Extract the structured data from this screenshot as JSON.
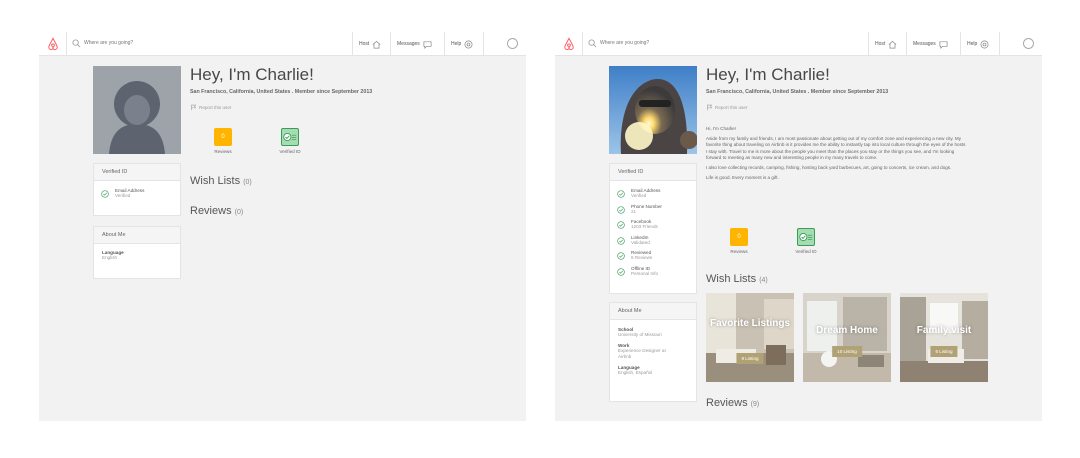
{
  "header": {
    "search_placeholder": "Where are you going?",
    "host_label": "Host",
    "messages_label": "Messages",
    "help_label": "Help"
  },
  "profile": {
    "title": "Hey, I'm Charlie!",
    "location_line": "San Francisco, California, United States . Member since September 2013",
    "report_label": "Report this user",
    "reviews_badge_count": "0",
    "reviews_badge_label": "Reviews",
    "verified_badge_label": "Verified ID",
    "wish_lists_label": "Wish Lists",
    "reviews_label": "Reviews"
  },
  "left": {
    "verified_card_title": "Verified ID",
    "verifications": [
      {
        "name": "Email Address",
        "status": "Verified"
      }
    ],
    "about_title": "About Me",
    "about": [
      {
        "key": "Language",
        "value": "English"
      }
    ],
    "wish_lists_count": "(0)",
    "reviews_count": "(0)"
  },
  "right": {
    "verified_card_title": "Verified ID",
    "verifications": [
      {
        "name": "Email Address",
        "status": "Verified"
      },
      {
        "name": "Phone Number",
        "status": "21"
      },
      {
        "name": "Facebook",
        "status": "1203 Friends"
      },
      {
        "name": "LinkedIn",
        "status": "Validated"
      },
      {
        "name": "Reviewed",
        "status": "6 Reviews"
      },
      {
        "name": "Offline ID",
        "status": "Personal Info"
      }
    ],
    "about_title": "About Me",
    "about": [
      {
        "key": "School",
        "value": "University of Missouri"
      },
      {
        "key": "Work",
        "value": "Experience Designer at Airbnb"
      },
      {
        "key": "Language",
        "value": "English, Español"
      }
    ],
    "bio": [
      "Hi, I'm Charlie!",
      "Aside from my family and friends, I am most passionate about getting out of my comfort zone and experiencing a new city. My favorite thing about traveling on Airbnb is it provides me the ability to instantly tap into local culture through the eyes of the hosts I stay with. Travel to me is more about the people you meet than the places you stay or the things you see, and I'm looking forward to meeting as many new and interesting people in my many travels to come.",
      "I also love collecting records, camping, fishing, hosting back yard barbecues, art, going to concerts, ice cream, and dogs.",
      "Life is good. Every moment is a gift."
    ],
    "wish_lists_count": "(4)",
    "reviews_count": "(9)",
    "wish_lists": [
      {
        "name": "Favorite Listings",
        "count": "9 Listing"
      },
      {
        "name": "Dream Home",
        "count": "10 Listing"
      },
      {
        "name": "Family visit",
        "count": "6 Listing"
      }
    ]
  },
  "colors": {
    "brand": "#ff5a5f",
    "reviews_badge": "#ffb400",
    "verified_green": "#3a9c58",
    "wishlist_count_bg": "#b1a276"
  }
}
